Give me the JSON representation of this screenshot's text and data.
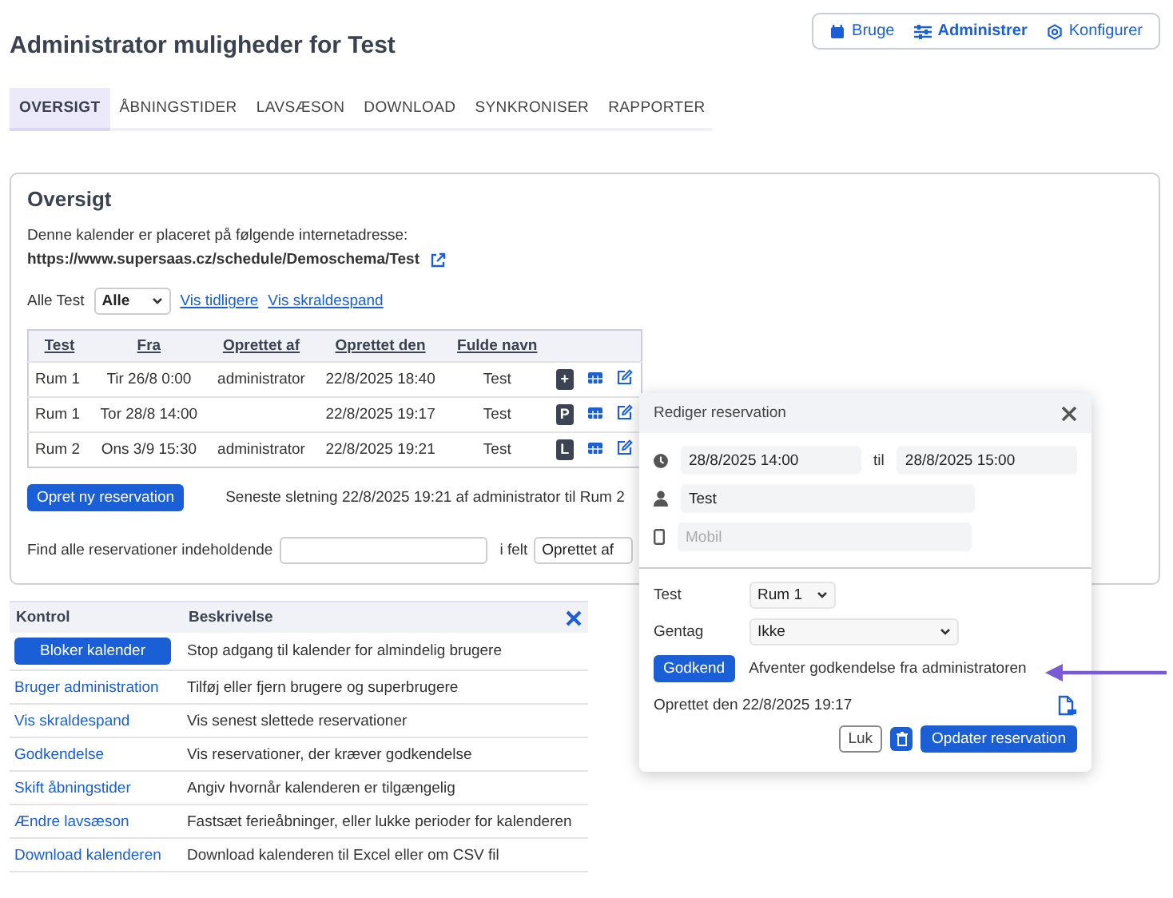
{
  "page": {
    "title": "Administrator muligheder for Test"
  },
  "view_switch": [
    {
      "label": "Bruge",
      "kind": "calendar",
      "selected": false
    },
    {
      "label": "Administrer",
      "kind": "sliders",
      "selected": true
    },
    {
      "label": "Konfigurer",
      "kind": "gear",
      "selected": false
    }
  ],
  "tabs": [
    {
      "label": "OVERSIGT",
      "selected": true
    },
    {
      "label": "ÅBNINGSTIDER",
      "selected": false
    },
    {
      "label": "LAVSÆSON",
      "selected": false
    },
    {
      "label": "DOWNLOAD",
      "selected": false
    },
    {
      "label": "SYNKRONISER",
      "selected": false
    },
    {
      "label": "RAPPORTER",
      "selected": false
    }
  ],
  "overview": {
    "title": "Oversigt",
    "intro": "Denne kalender er placeret på følgende internetadresse:",
    "url": "https://www.supersaas.cz/schedule/Demoschema/Test",
    "filter_label": "Alle Test",
    "filter_value": "Alle",
    "links": [
      "Vis tidligere",
      "Vis skraldespand"
    ],
    "table": {
      "columns": [
        "Test",
        "Fra",
        "Oprettet af",
        "Oprettet den",
        "Fulde navn"
      ],
      "rows": [
        {
          "cells": [
            "Rum 1",
            "Tir 26/8 0:00",
            "administrator",
            "22/8/2025 18:40",
            "Test"
          ],
          "badge": "+"
        },
        {
          "cells": [
            "Rum 1",
            "Tor 28/8 14:00",
            "",
            "22/8/2025 19:17",
            "Test"
          ],
          "badge": "P"
        },
        {
          "cells": [
            "Rum 2",
            "Ons 3/9 15:30",
            "administrator",
            "22/8/2025 19:21",
            "Test"
          ],
          "badge": "L"
        }
      ]
    },
    "new_button": "Opret ny reservation",
    "last_deletion": "Seneste sletning 22/8/2025 19:21 af administrator til Rum 2",
    "search_label": "Find alle reservationer indeholdende",
    "field_label": "i felt",
    "field_value": "Oprettet af"
  },
  "controls": {
    "columns": [
      "Kontrol",
      "Beskrivelse"
    ],
    "rows": [
      {
        "control": "Bloker kalender",
        "kind": "button",
        "description": "Stop adgang til kalender for almindelig brugere"
      },
      {
        "control": "Bruger administration",
        "kind": "link",
        "description": "Tilføj eller fjern brugere og superbrugere"
      },
      {
        "control": "Vis skraldespand",
        "kind": "link",
        "description": "Vis senest slettede reservationer"
      },
      {
        "control": "Godkendelse",
        "kind": "link",
        "description": "Vis reservationer, der kræver godkendelse"
      },
      {
        "control": "Skift åbningstider",
        "kind": "link",
        "description": "Angiv hvornår kalenderen er tilgængelig"
      },
      {
        "control": "Ændre lavsæson",
        "kind": "link",
        "description": "Fastsæt ferieåbninger, eller lukke perioder for kalenderen"
      },
      {
        "control": "Download kalenderen",
        "kind": "link",
        "description": "Download kalenderen til Excel eller om CSV fil"
      }
    ]
  },
  "dialog": {
    "title": "Rediger reservation",
    "start": "28/8/2025  14:00",
    "to_label": "til",
    "end": "28/8/2025  15:00",
    "name": "Test",
    "phone_placeholder": "Mobil",
    "resource_label": "Test",
    "resource": "Rum 1",
    "repeat_label": "Gentag",
    "repeat": "Ikke",
    "approve_button": "Godkend",
    "approve_status": "Afventer godkendelse fra administratoren",
    "created": "Oprettet den 22/8/2025 19:17",
    "close_button": "Luk",
    "update_button": "Opdater reservation"
  }
}
